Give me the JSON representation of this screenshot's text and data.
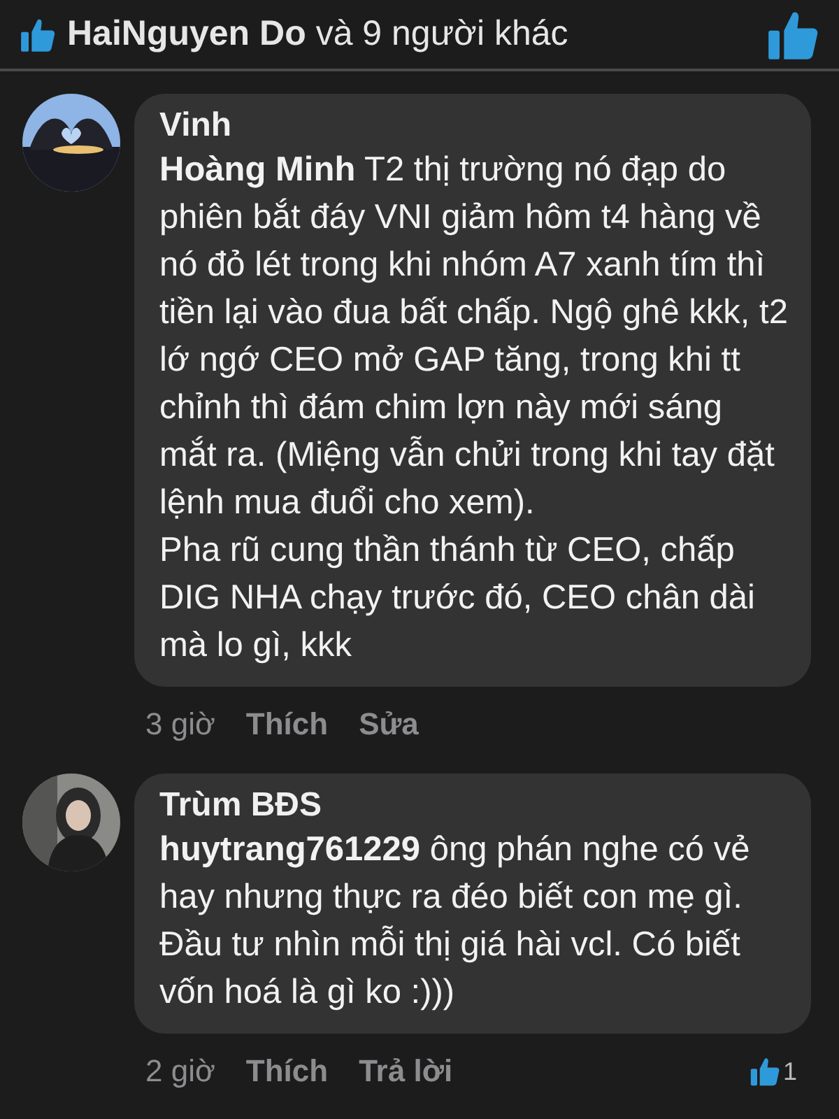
{
  "likes_bar": {
    "names": "HaiNguyen Do",
    "others": "và 9 người khác"
  },
  "comments": [
    {
      "author": "Vinh",
      "avatar": {
        "kind": "picture"
      },
      "paragraphs": [
        "**Hoàng Minh**  T2 thị trường nó đạp do phiên bắt đáy VNI giảm hôm t4 hàng về nó đỏ lét trong khi nhóm A7 xanh tím thì tiền lại vào đua bất chấp. Ngộ ghê kkk, t2 lớ ngớ CEO mở GAP tăng, trong khi tt chỉnh thì đám chim lợn này mới sáng mắt ra. (Miệng vẫn chửi trong khi tay đặt lệnh mua đuổi cho xem).",
        "Pha rũ cung thần thánh từ CEO, chấp DIG NHA chạy trước đó, CEO chân dài mà lo gì, kkk"
      ],
      "time": "3 giờ",
      "actions": [
        "Thích",
        "Sửa"
      ]
    },
    {
      "author": "Trùm BĐS",
      "avatar": {
        "kind": "picture"
      },
      "paragraphs": [
        "**huytrang761229**  ông phán nghe có vẻ hay nhưng thực ra đéo biết con mẹ gì. Đầu tư nhìn mỗi thị giá hài vcl. Có biết vốn hoá là gì ko :)))"
      ],
      "time": "2 giờ",
      "actions": [
        "Thích",
        "Trả lời"
      ],
      "like_count": "1"
    }
  ]
}
